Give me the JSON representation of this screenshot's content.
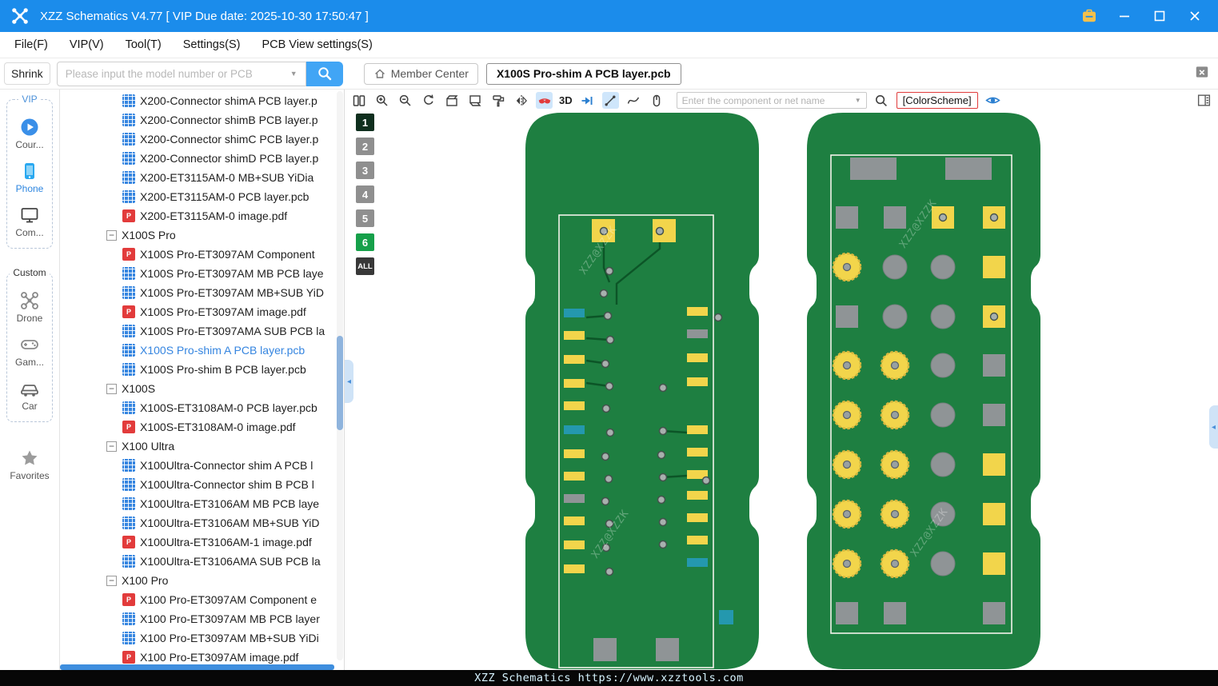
{
  "app": {
    "title": "XZZ Schematics V4.77 [ VIP Due date: 2025-10-30 17:50:47 ]"
  },
  "menubar": {
    "items": [
      {
        "label": "File(F)"
      },
      {
        "label": "VIP(V)"
      },
      {
        "label": "Tool(T)"
      },
      {
        "label": "Settings(S)"
      },
      {
        "label": "PCB View settings(S)"
      }
    ]
  },
  "searchbar": {
    "shrink_label": "Shrink",
    "placeholder": "Please input the model number or PCB"
  },
  "tabbar": {
    "member_center_label": "Member Center",
    "active_tab": "X100S Pro-shim A PCB layer.pcb"
  },
  "sidebar": {
    "vip_group_label": "VIP",
    "custom_group_label": "Custom",
    "favorites_label": "Favorites",
    "vip_items": [
      {
        "id": "courses",
        "label": "Cour...",
        "icon": "course-play-icon",
        "highlight": false
      },
      {
        "id": "phone",
        "label": "Phone",
        "icon": "phone-icon",
        "highlight": true
      },
      {
        "id": "computer",
        "label": "Com...",
        "icon": "computer-icon",
        "highlight": false
      }
    ],
    "custom_items": [
      {
        "id": "drone",
        "label": "Drone",
        "icon": "drone-icon",
        "highlight": false
      },
      {
        "id": "game",
        "label": "Gam...",
        "icon": "gamepad-icon",
        "highlight": false
      },
      {
        "id": "car",
        "label": "Car",
        "icon": "car-icon",
        "highlight": false
      }
    ]
  },
  "tree": {
    "items": [
      {
        "label": "X200-Connector shimA PCB layer.p",
        "type": "pcb"
      },
      {
        "label": "X200-Connector shimB PCB layer.p",
        "type": "pcb"
      },
      {
        "label": "X200-Connector shimC PCB layer.p",
        "type": "pcb"
      },
      {
        "label": "X200-Connector shimD PCB layer.p",
        "type": "pcb"
      },
      {
        "label": "X200-ET3115AM-0 MB+SUB YiDia",
        "type": "pcb"
      },
      {
        "label": "X200-ET3115AM-0 PCB layer.pcb",
        "type": "pcb"
      },
      {
        "label": "X200-ET3115AM-0 image.pdf",
        "type": "pdf"
      },
      {
        "label": "X100S Pro",
        "type": "group"
      },
      {
        "label": "X100S Pro-ET3097AM Component",
        "type": "pdf"
      },
      {
        "label": "X100S Pro-ET3097AM MB PCB laye",
        "type": "pcb"
      },
      {
        "label": "X100S Pro-ET3097AM MB+SUB YiD",
        "type": "pcb"
      },
      {
        "label": "X100S Pro-ET3097AM image.pdf",
        "type": "pdf"
      },
      {
        "label": "X100S Pro-ET3097AMA SUB PCB la",
        "type": "pcb"
      },
      {
        "label": "X100S Pro-shim A PCB layer.pcb",
        "type": "pcb",
        "selected": true
      },
      {
        "label": "X100S Pro-shim B PCB layer.pcb",
        "type": "pcb"
      },
      {
        "label": "X100S",
        "type": "group"
      },
      {
        "label": "X100S-ET3108AM-0 PCB layer.pcb",
        "type": "pcb"
      },
      {
        "label": "X100S-ET3108AM-0 image.pdf",
        "type": "pdf"
      },
      {
        "label": "X100 Ultra",
        "type": "group"
      },
      {
        "label": "X100Ultra-Connector shim A PCB l",
        "type": "pcb"
      },
      {
        "label": "X100Ultra-Connector shim B PCB l",
        "type": "pcb"
      },
      {
        "label": "X100Ultra-ET3106AM MB PCB laye",
        "type": "pcb"
      },
      {
        "label": "X100Ultra-ET3106AM MB+SUB YiD",
        "type": "pcb"
      },
      {
        "label": "X100Ultra-ET3106AM-1 image.pdf",
        "type": "pdf"
      },
      {
        "label": "X100Ultra-ET3106AMA SUB PCB la",
        "type": "pcb"
      },
      {
        "label": "X100 Pro",
        "type": "group"
      },
      {
        "label": "X100 Pro-ET3097AM Component e",
        "type": "pdf"
      },
      {
        "label": "X100 Pro-ET3097AM MB PCB layer",
        "type": "pcb"
      },
      {
        "label": "X100 Pro-ET3097AM MB+SUB YiDi",
        "type": "pcb"
      },
      {
        "label": "X100 Pro-ET3097AM image.pdf",
        "type": "pdf"
      },
      {
        "label": "",
        "type": "pdf"
      }
    ]
  },
  "toolbar": {
    "mode_3d_label": "3D",
    "colorscheme_label": "[ColorScheme]",
    "search_placeholder": "Enter the component or net name",
    "icons": [
      "split-view",
      "zoom-in",
      "zoom-out",
      "rotate",
      "top-layer-box",
      "bottom-layer-box",
      "paint-roller",
      "flip-horizontal",
      "net-goggles",
      "3d-toggle",
      "jump-arrow",
      "measure-line",
      "curve",
      "mouse-mode",
      "net-search",
      "layer-eye",
      "panel-list"
    ]
  },
  "layers": {
    "active": "6",
    "items": [
      {
        "label": "1",
        "color": "#0f2f1e"
      },
      {
        "label": "2",
        "color": "#8f8f8f"
      },
      {
        "label": "3",
        "color": "#8f8f8f"
      },
      {
        "label": "4",
        "color": "#8f8f8f"
      },
      {
        "label": "5",
        "color": "#8f8f8f"
      },
      {
        "label": "6",
        "color": "#16a04a"
      },
      {
        "label": "ALL",
        "color": "#383838"
      }
    ]
  },
  "canvas": {
    "watermark": "XZZ@XZZK"
  },
  "statusbar": {
    "text": "XZZ Schematics https://www.xzztools.com"
  },
  "colors": {
    "titlebar_blue": "#1b8ceb",
    "accent_blue": "#2e86e0",
    "board_green": "#1e7f41",
    "trace_green": "#0c5527",
    "pad_yellow": "#f2d54b",
    "pad_gray": "#8f9496",
    "pad_teal": "#2498ae",
    "layer_active_green": "#16a04a",
    "colorscheme_border_red": "#e03b3b"
  }
}
